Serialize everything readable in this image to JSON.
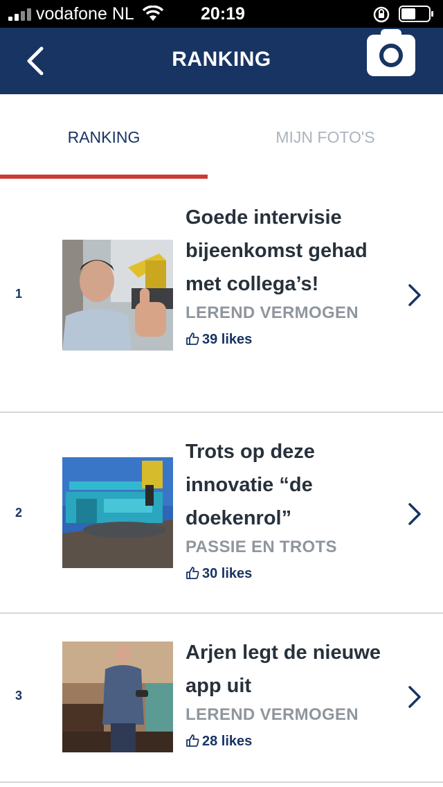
{
  "status_bar": {
    "carrier": "vodafone NL",
    "time": "20:19",
    "icons": [
      "signal-icon",
      "wifi-icon",
      "rotation-lock-icon",
      "battery-icon"
    ]
  },
  "nav": {
    "title": "RANKING",
    "back_icon": "chevron-left-icon",
    "camera_icon": "camera-icon",
    "color": "#173463"
  },
  "tabs": [
    {
      "label": "RANKING",
      "active": true
    },
    {
      "label": "MIJN FOTO'S",
      "active": false
    }
  ],
  "accent_color": "#cc3b33",
  "items": [
    {
      "rank": "1",
      "title": "Goede intervisie bijeenkomst gehad met collega’s!",
      "category": "LEREND VERMOGEN",
      "likes": "39 likes",
      "photo": "man giving thumbs up in front of excavator"
    },
    {
      "rank": "2",
      "title": "Trots op deze innovatie “de doekenrol”",
      "category": "PASSIE EN TROTS",
      "likes": "30 likes",
      "photo": "blue cloth roll machine on construction site"
    },
    {
      "rank": "3",
      "title": "Arjen legt de nieuwe app uit",
      "category": "LEREND VERMOGEN",
      "likes": "28 likes",
      "photo": "man presenting in a lounge"
    }
  ]
}
